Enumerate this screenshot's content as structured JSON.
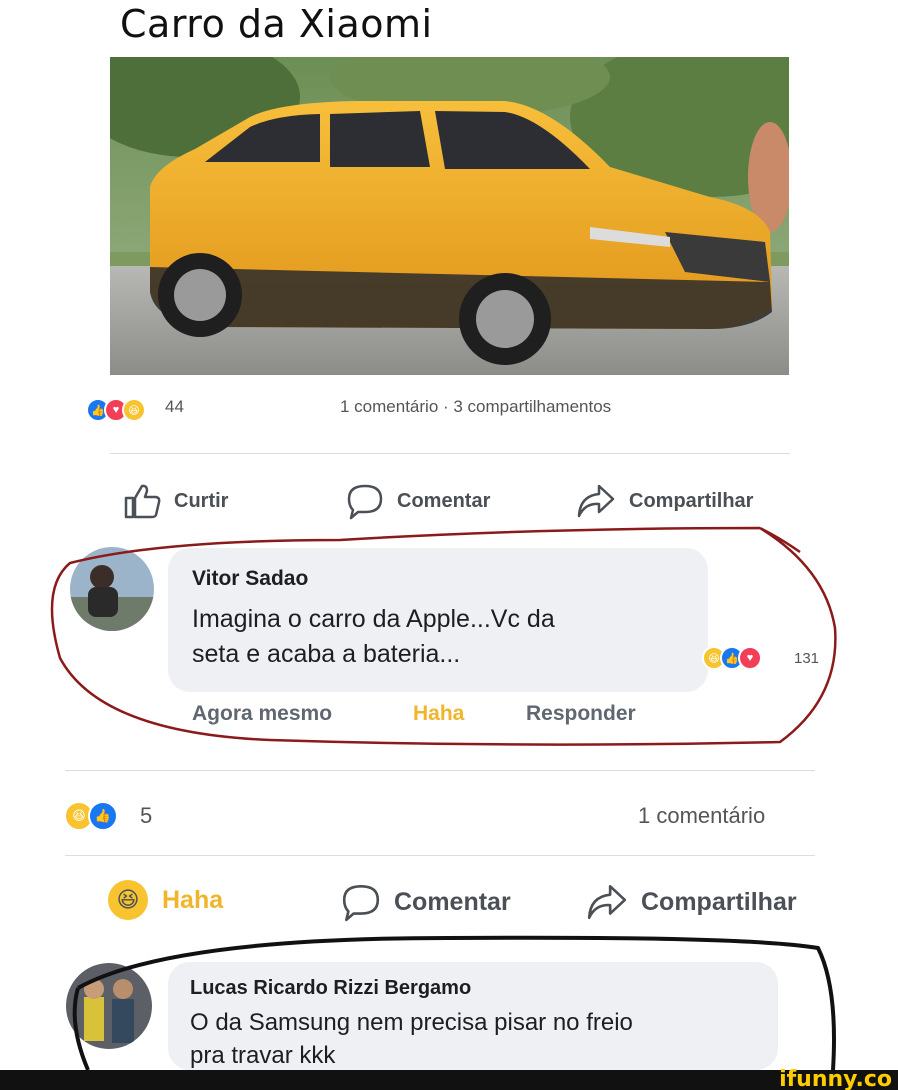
{
  "title": "Carro da Xiaomi",
  "post": {
    "reaction_count": "44",
    "counts_text": "1 comentário · 3 compartilhamentos",
    "actions": {
      "like": "Curtir",
      "comment": "Comentar",
      "share": "Compartilhar"
    }
  },
  "comment1": {
    "author": "Vitor Sadao",
    "line1": "Imagina o carro da Apple...Vc da",
    "line2": "seta e acaba a bateria...",
    "reaction_count": "131",
    "time": "Agora mesmo",
    "reaction_label": "Haha",
    "reply": "Responder"
  },
  "post2": {
    "reaction_count": "5",
    "counts_text": "1 comentário",
    "actions": {
      "haha": "Haha",
      "comment": "Comentar",
      "share": "Compartilhar"
    }
  },
  "comment2": {
    "author": "Lucas Ricardo Rizzi Bergamo",
    "line1": "O da Samsung nem precisa pisar no freio",
    "line2": "pra travar kkk"
  },
  "watermark": "ifunny.co",
  "colors": {
    "like": "#1877f2",
    "love": "#f33e58",
    "haha": "#f7c32e",
    "haha_text": "#f0b52a",
    "car": "#f2a81d"
  }
}
